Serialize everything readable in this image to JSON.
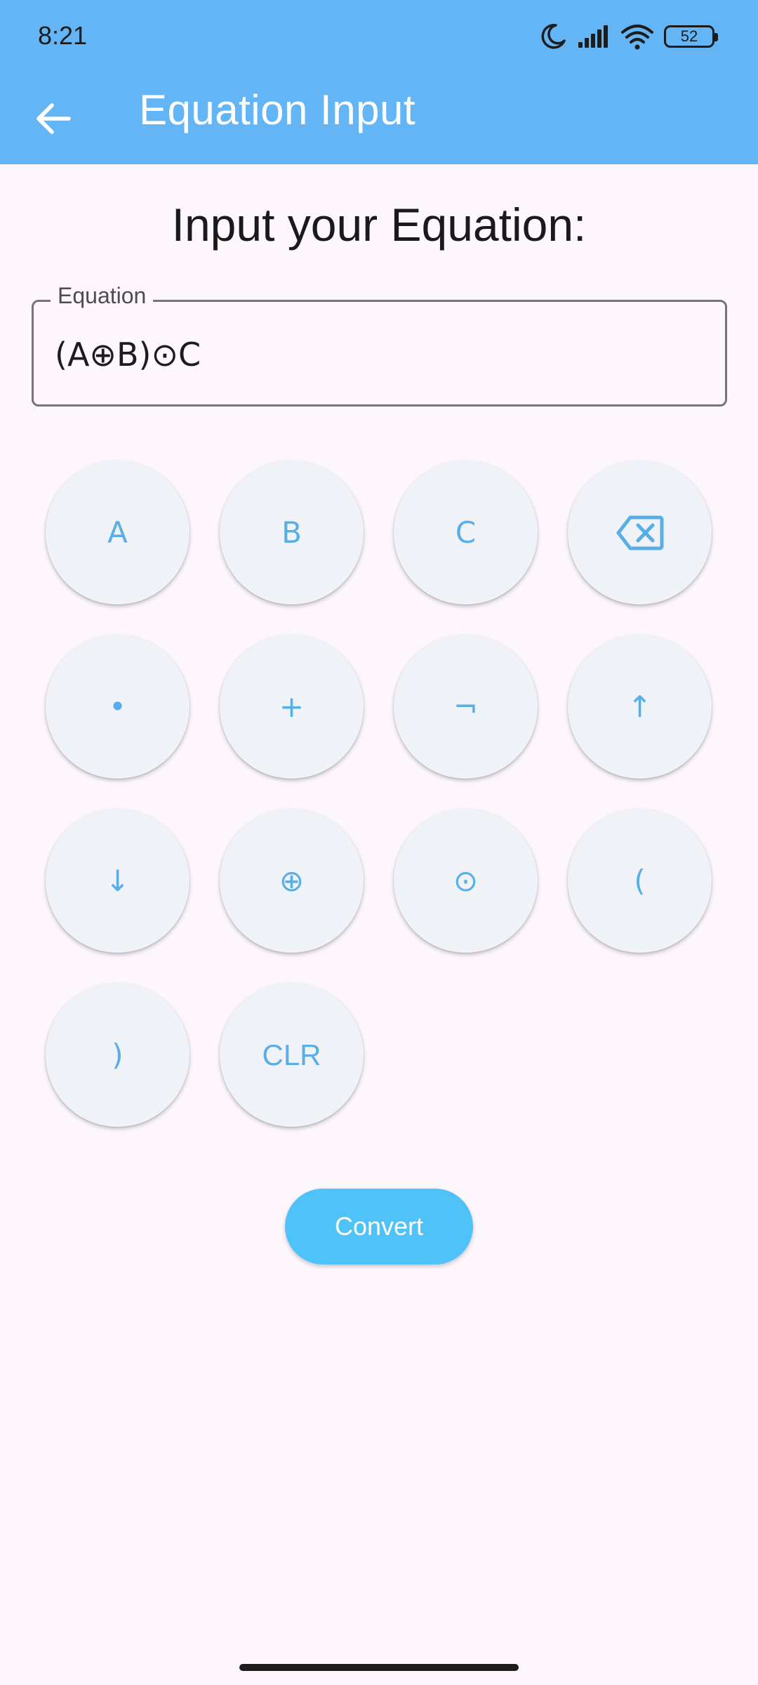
{
  "status_bar": {
    "time": "8:21",
    "battery_level": "52",
    "icons": [
      "moon-icon",
      "signal-icon",
      "wifi-icon",
      "battery-icon"
    ]
  },
  "toolbar": {
    "title": "Equation Input",
    "back_icon": "arrow-back-icon"
  },
  "prompt": "Input your Equation:",
  "equation_field": {
    "label": "Equation",
    "value": "(A⊕B)⊙C"
  },
  "keypad": {
    "keys": [
      {
        "label": "A",
        "name": "key-a"
      },
      {
        "label": "B",
        "name": "key-b"
      },
      {
        "label": "C",
        "name": "key-c"
      },
      {
        "label": "",
        "name": "backspace-button",
        "icon": "backspace-icon"
      },
      {
        "label": "•",
        "name": "key-and"
      },
      {
        "label": "+",
        "name": "key-or"
      },
      {
        "label": "¬",
        "name": "key-not"
      },
      {
        "label": "↑",
        "name": "key-nand"
      },
      {
        "label": "↓",
        "name": "key-nor"
      },
      {
        "label": "⊕",
        "name": "key-xor"
      },
      {
        "label": "⊙",
        "name": "key-xnor"
      },
      {
        "label": "(",
        "name": "key-open-paren"
      },
      {
        "label": ")",
        "name": "key-close-paren"
      },
      {
        "label": "CLR",
        "name": "clear-button"
      }
    ]
  },
  "convert_label": "Convert",
  "colors": {
    "app_bar": "#64b5f6",
    "background": "#fdf7fd",
    "key_background": "#eff2f7",
    "key_text": "#5aaee6",
    "convert_button": "#4fc3f7"
  }
}
